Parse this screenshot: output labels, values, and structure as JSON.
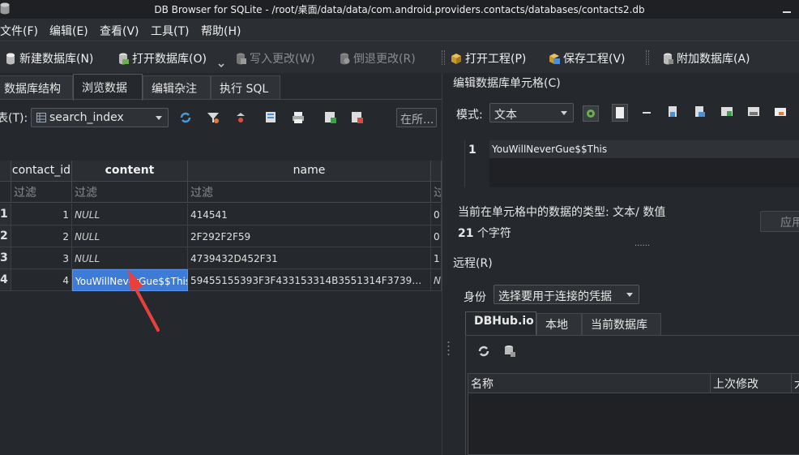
{
  "window": {
    "title": "DB Browser for SQLite - /root/桌面/data/data/com.android.providers.contacts/databases/contacts2.db"
  },
  "menu": {
    "file": "文件(F)",
    "edit": "编辑(E)",
    "view": "查看(V)",
    "tools": "工具(T)",
    "help": "帮助(H)"
  },
  "toolbar": {
    "new_db": "新建数据库(N)",
    "open_db": "打开数据库(O)",
    "write_changes": "写入更改(W)",
    "revert_changes": "倒退更改(R)",
    "open_project": "打开工程(P)",
    "save_project": "保存工程(V)",
    "attach_db": "附加数据库(A)"
  },
  "tabs": [
    "数据库结构",
    "浏览数据",
    "编辑杂注",
    "执行 SQL"
  ],
  "browse": {
    "table_label": "表(T):",
    "table_selected": "search_index",
    "find_button": "在所...",
    "columns": [
      "contact_id",
      "content",
      "name"
    ],
    "filter_placeholder": "过滤",
    "rows": [
      {
        "rownum": "1",
        "contact_id": "1",
        "content": "NULL",
        "name": "414541",
        "extra": "0"
      },
      {
        "rownum": "2",
        "contact_id": "2",
        "content": "NULL",
        "name": "2F292F2F59",
        "extra": "0"
      },
      {
        "rownum": "3",
        "contact_id": "3",
        "content": "NULL",
        "name": "4739432D452F31",
        "extra": "1"
      },
      {
        "rownum": "4",
        "contact_id": "4",
        "content": "YouWillNeverGue$$This",
        "name": "59455155393F3F433153314B3551314F3739…",
        "extra": "N"
      }
    ],
    "selected_row": 4,
    "selected_column": "content"
  },
  "cell_editor": {
    "title": "编辑数据库单元格(C)",
    "mode_label": "模式:",
    "mode_value": "文本",
    "line_number": "1",
    "content": "YouWillNeverGue$$This",
    "type_info": "当前在单元格中的数据的类型: 文本/ 数值",
    "char_count": "21",
    "char_count_suffix": "个字符",
    "apply_button": "应用",
    "splitter_dots": "......"
  },
  "remote": {
    "title": "远程(R)",
    "identity_label": "身份",
    "identity_value": "选择要用于连接的凭据",
    "tabs": [
      "DBHub.io",
      "本地",
      "当前数据库"
    ],
    "columns": [
      "名称",
      "上次修改",
      "大"
    ]
  },
  "colors": {
    "background": "#25282c",
    "selection": "#3d7bd8",
    "annotation_arrow": "#e8403a"
  },
  "icons": [
    "app-db-icon",
    "close-window-icon",
    "new-db-icon",
    "open-db-icon",
    "write-changes-icon",
    "revert-changes-icon",
    "open-project-icon",
    "save-project-icon",
    "attach-db-icon",
    "table-icon",
    "refresh-icon",
    "filter-icon",
    "clear-filter-icon",
    "save-filter-icon",
    "print-icon",
    "insert-record-icon",
    "delete-record-icon",
    "settings-icon",
    "text-mode-icon",
    "null-icon",
    "import-icon",
    "export-icon",
    "set-as-null-icon",
    "print-cell-icon",
    "apply-icon",
    "clone-icon"
  ]
}
